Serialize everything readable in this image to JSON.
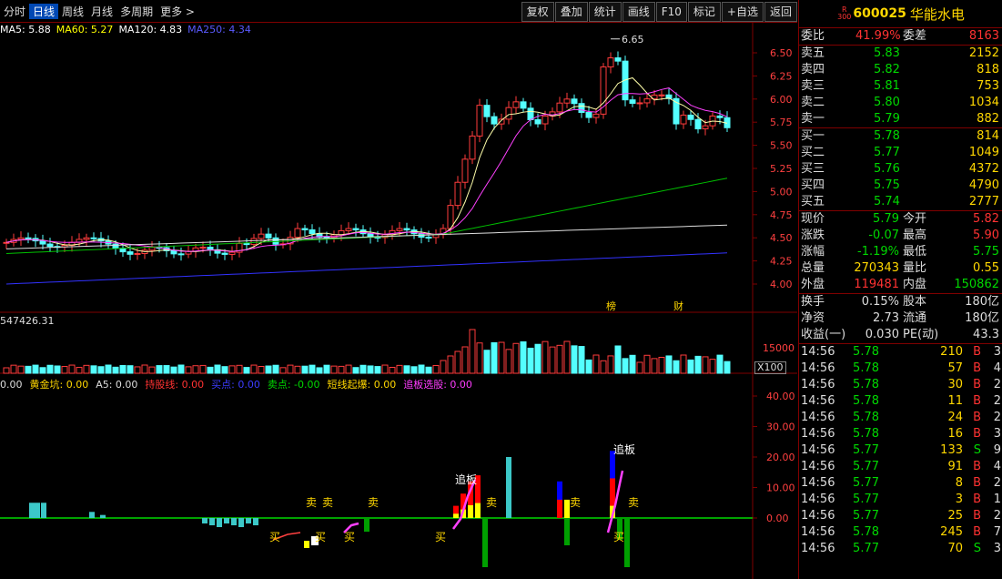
{
  "toolbar": {
    "left_items": [
      "分时",
      "日线",
      "周线",
      "月线",
      "多周期",
      "更多 >"
    ],
    "right_buttons": [
      "复权",
      "叠加",
      "统计",
      "画线",
      "F10",
      "标记",
      "+自选",
      "返回"
    ]
  },
  "ma_legend": [
    {
      "label": "MA5: 5.88",
      "color": "#ffffff"
    },
    {
      "label": "MA60: 5.27",
      "color": "#ffff00"
    },
    {
      "label": "MA120: 4.83",
      "color": "#ffffff"
    },
    {
      "label": "MA250: 4.34",
      "color": "#5a5aff"
    }
  ],
  "price_axis": [
    "6.50",
    "6.25",
    "6.00",
    "5.75",
    "5.50",
    "5.25",
    "5.00",
    "4.75",
    "4.50",
    "4.25",
    "4.00"
  ],
  "high_marker": "6.65",
  "markers": [
    "榜",
    "财"
  ],
  "volume": {
    "legend": "547426.31",
    "axis": "15000",
    "unit": "X100"
  },
  "indicator": {
    "legend": [
      {
        "label": "0.00",
        "color": "#dddddd"
      },
      {
        "label": "黄金坑: 0.00",
        "color": "#ffd700"
      },
      {
        "label": "A5: 0.00",
        "color": "#dddddd"
      },
      {
        "label": "持股线: 0.00",
        "color": "#ff3232"
      },
      {
        "label": "买点: 0.00",
        "color": "#3c3cff"
      },
      {
        "label": "卖点: -0.00",
        "color": "#00d800"
      },
      {
        "label": "短线起爆: 0.00",
        "color": "#ffd700"
      },
      {
        "label": "追板选股: 0.00",
        "color": "#ff3cff"
      }
    ],
    "axis": [
      "40.00",
      "30.00",
      "20.00",
      "10.00",
      "0.00"
    ],
    "labels_buy": [
      "买",
      "买",
      "买",
      "买",
      "买"
    ],
    "labels_sell": [
      "卖",
      "卖",
      "卖",
      "卖",
      "卖",
      "卖"
    ],
    "labels_chase": [
      "追板",
      "追板"
    ]
  },
  "stock": {
    "tag_top": "R",
    "tag_bottom": "300",
    "code": "600025",
    "name": "华能水电"
  },
  "order_book": {
    "weibi_label": "委比",
    "weibi_value": "41.99%",
    "weicha_label": "委差",
    "weicha_value": "8163",
    "asks": [
      {
        "label": "卖五",
        "price": "5.83",
        "volume": "2152"
      },
      {
        "label": "卖四",
        "price": "5.82",
        "volume": "818"
      },
      {
        "label": "卖三",
        "price": "5.81",
        "volume": "753"
      },
      {
        "label": "卖二",
        "price": "5.80",
        "volume": "1034"
      },
      {
        "label": "卖一",
        "price": "5.79",
        "volume": "882"
      }
    ],
    "bids": [
      {
        "label": "买一",
        "price": "5.78",
        "volume": "814"
      },
      {
        "label": "买二",
        "price": "5.77",
        "volume": "1049"
      },
      {
        "label": "买三",
        "price": "5.76",
        "volume": "4372"
      },
      {
        "label": "买四",
        "price": "5.75",
        "volume": "4790"
      },
      {
        "label": "买五",
        "price": "5.74",
        "volume": "2777"
      }
    ]
  },
  "stats": [
    {
      "l1": "现价",
      "v1": "5.79",
      "c1": "g",
      "l2": "今开",
      "v2": "5.82",
      "c2": "r"
    },
    {
      "l1": "涨跌",
      "v1": "-0.07",
      "c1": "g",
      "l2": "最高",
      "v2": "5.90",
      "c2": "r"
    },
    {
      "l1": "涨幅",
      "v1": "-1.19%",
      "c1": "g",
      "l2": "最低",
      "v2": "5.75",
      "c2": "g"
    },
    {
      "l1": "总量",
      "v1": "270343",
      "c1": "y",
      "l2": "量比",
      "v2": "0.55",
      "c2": "y"
    },
    {
      "l1": "外盘",
      "v1": "119481",
      "c1": "r",
      "l2": "内盘",
      "v2": "150862",
      "c2": "g"
    }
  ],
  "stats2": [
    {
      "l1": "换手",
      "v1": "0.15%",
      "l2": "股本",
      "v2": "180亿"
    },
    {
      "l1": "净资",
      "v1": "2.73",
      "l2": "流通",
      "v2": "180亿"
    },
    {
      "l1": "收益(一)",
      "v1": "0.030",
      "l2": "PE(动)",
      "v2": "43.3"
    }
  ],
  "ticks": [
    {
      "time": "14:56",
      "price": "5.78",
      "vol": "210",
      "side": "B",
      "num": "3"
    },
    {
      "time": "14:56",
      "price": "5.78",
      "vol": "57",
      "side": "B",
      "num": "4"
    },
    {
      "time": "14:56",
      "price": "5.78",
      "vol": "30",
      "side": "B",
      "num": "2"
    },
    {
      "time": "14:56",
      "price": "5.78",
      "vol": "11",
      "side": "B",
      "num": "2"
    },
    {
      "time": "14:56",
      "price": "5.78",
      "vol": "24",
      "side": "B",
      "num": "2"
    },
    {
      "time": "14:56",
      "price": "5.78",
      "vol": "16",
      "side": "B",
      "num": "3"
    },
    {
      "time": "14:56",
      "price": "5.77",
      "vol": "133",
      "side": "S",
      "num": "9"
    },
    {
      "time": "14:56",
      "price": "5.77",
      "vol": "91",
      "side": "B",
      "num": "4"
    },
    {
      "time": "14:56",
      "price": "5.77",
      "vol": "8",
      "side": "B",
      "num": "2"
    },
    {
      "time": "14:56",
      "price": "5.77",
      "vol": "3",
      "side": "B",
      "num": "1"
    },
    {
      "time": "14:56",
      "price": "5.77",
      "vol": "25",
      "side": "B",
      "num": "2"
    },
    {
      "time": "14:56",
      "price": "5.78",
      "vol": "245",
      "side": "B",
      "num": "7"
    },
    {
      "time": "14:56",
      "price": "5.77",
      "vol": "70",
      "side": "S",
      "num": "3"
    }
  ]
}
